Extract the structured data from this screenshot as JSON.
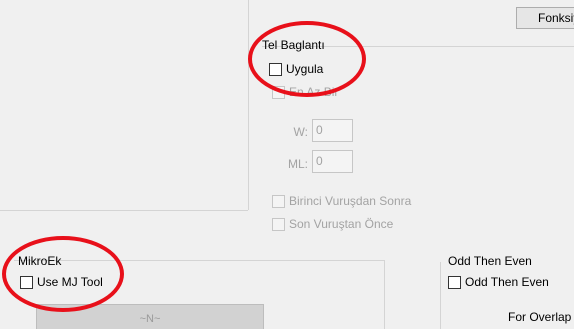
{
  "top_tab": {
    "label": "Fonksiy"
  },
  "tel_baglanti": {
    "title": "Tel Baglantı",
    "uygula_label": "Uygula",
    "en_az_bir_label": "En Az Bir",
    "w_label": "W:",
    "w_value": "0",
    "ml_label": "ML:",
    "ml_value": "0",
    "birinci_label": "Birinci Vuruşdan Sonra",
    "son_label": "Son Vuruştan Önce"
  },
  "mikroek": {
    "title": "MikroEk",
    "use_mj_tool_label": "Use MJ Tool",
    "button_label": "~N~"
  },
  "odd_then_even": {
    "title": "Odd Then Even",
    "checkbox_label": "Odd Then Even",
    "for_overlap_label": "For Overlap"
  },
  "colors": {
    "highlight_ring": "#e8101a"
  }
}
